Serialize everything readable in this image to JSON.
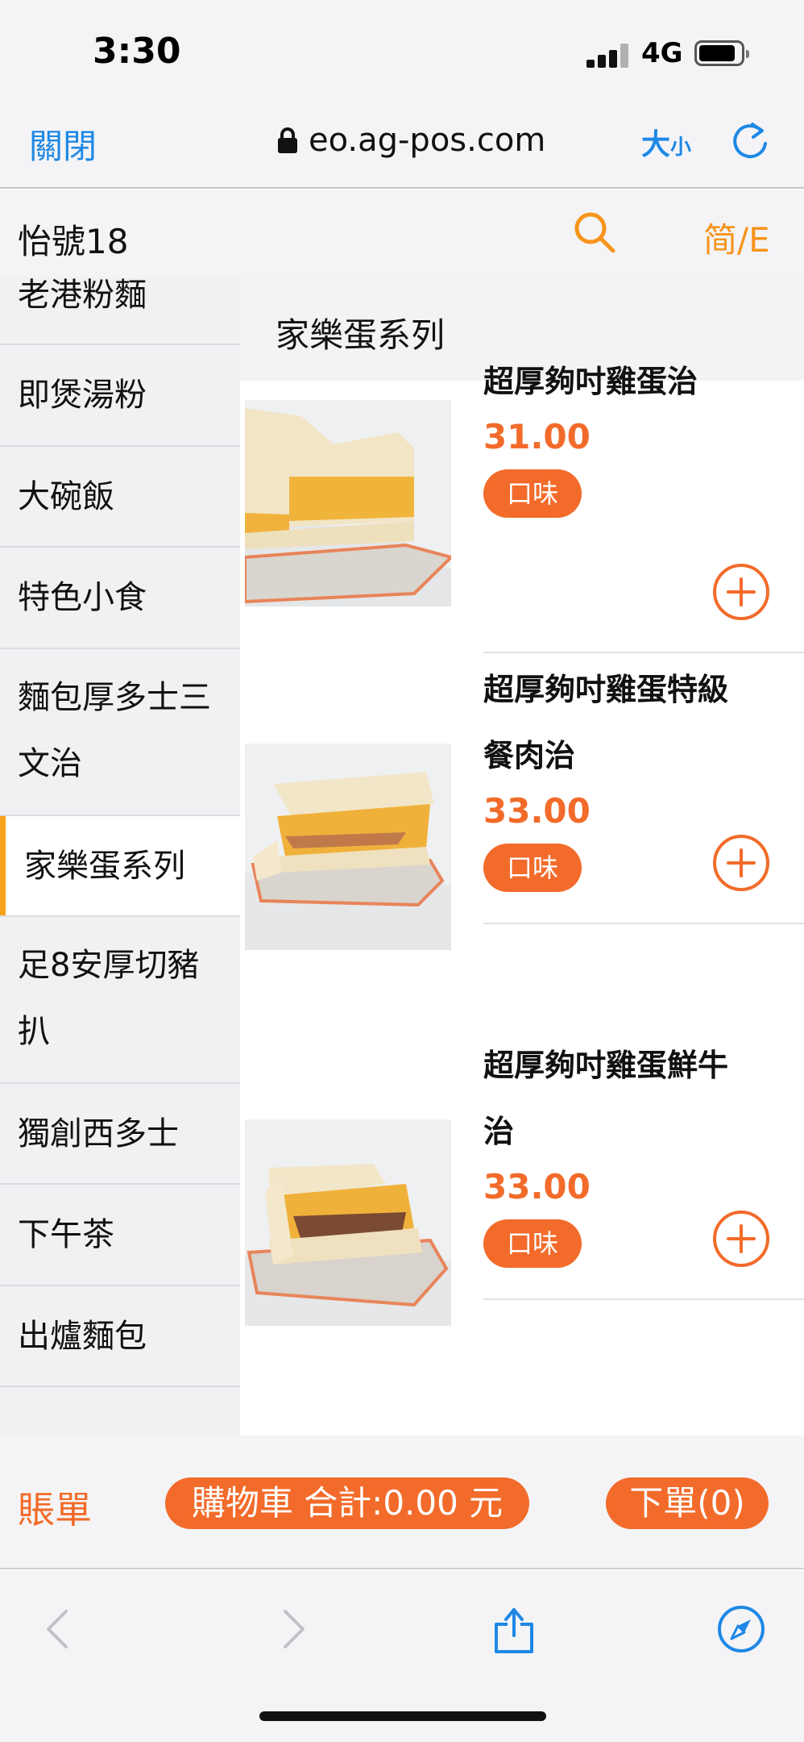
{
  "status_bar": {
    "time": "3:30",
    "network": "4G"
  },
  "browser": {
    "close_label": "關閉",
    "url": "eo.ag-pos.com",
    "text_size_big": "大",
    "text_size_small": "小"
  },
  "store": {
    "name": "怡號18",
    "language_label": "简/E"
  },
  "sidebar": {
    "items": [
      {
        "label": "老港粉麵"
      },
      {
        "label": "即煲湯粉"
      },
      {
        "label": "大碗飯"
      },
      {
        "label": "特色小食"
      },
      {
        "label_line1": "麵包厚多士三",
        "label_line2": "文治"
      },
      {
        "label": "家樂蛋系列",
        "active": true
      },
      {
        "label_line1": "足8安厚切豬",
        "label_line2": "扒"
      },
      {
        "label": "獨創西多士"
      },
      {
        "label": "下午茶"
      },
      {
        "label": "出爐麵包"
      }
    ]
  },
  "category": {
    "title": "家樂蛋系列"
  },
  "products": [
    {
      "name_line1": "超厚夠吋雞蛋治",
      "name_line2": "",
      "price": "31.00",
      "option_label": "口味"
    },
    {
      "name_line1": "超厚夠吋雞蛋特級",
      "name_line2": "餐肉治",
      "price": "33.00",
      "option_label": "口味"
    },
    {
      "name_line1": "超厚夠吋雞蛋鮮牛",
      "name_line2": "治",
      "price": "33.00",
      "option_label": "口味"
    }
  ],
  "order_bar": {
    "bill_label": "賬單",
    "cart_label": "購物車 合計:0.00 元",
    "order_label": "下單(0)"
  },
  "colors": {
    "accent_orange": "#f26b2a",
    "active_bar": "#f7a21b",
    "link_blue": "#1e88e5"
  }
}
